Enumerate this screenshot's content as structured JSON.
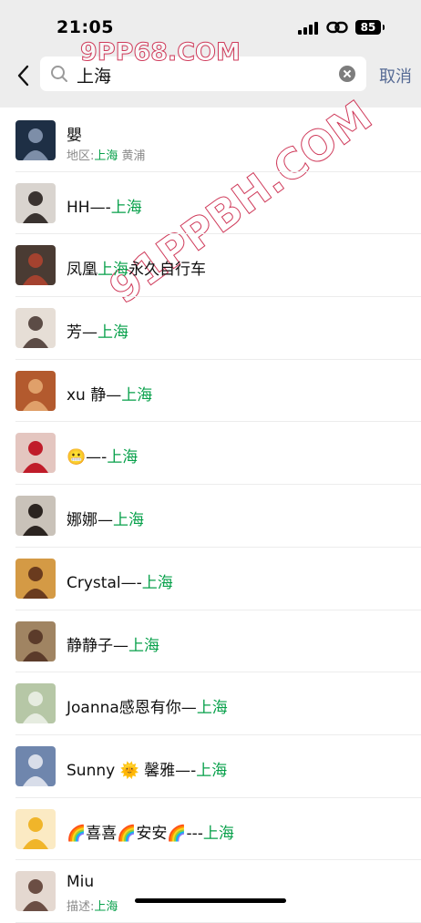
{
  "status": {
    "time": "21:05",
    "battery": "85"
  },
  "search": {
    "query": "上海",
    "cancel_label": "取消"
  },
  "watermark": {
    "top": "9PP68.COM",
    "diagonal": "91PPBH.COM"
  },
  "results": [
    {
      "name_pre": "嬰",
      "name_hl": "",
      "name_post": "",
      "sub_pre": "地区:",
      "sub_hl": "上海",
      "sub_post": " 黄浦",
      "avatar_bg": "#1e2f45",
      "avatar_fg": "#7d8ea8"
    },
    {
      "name_pre": "HH—-",
      "name_hl": "上海",
      "name_post": "",
      "avatar_bg": "#d9d4cf",
      "avatar_fg": "#3a3330"
    },
    {
      "name_pre": "凤凰",
      "name_hl": "上海",
      "name_post": "永久自行车",
      "avatar_bg": "#4a3b33",
      "avatar_fg": "#a4422f"
    },
    {
      "name_pre": "芳—",
      "name_hl": "上海",
      "name_post": "",
      "avatar_bg": "#e6ded6",
      "avatar_fg": "#5c4c46"
    },
    {
      "name_pre": "xu 静—",
      "name_hl": "上海",
      "name_post": "",
      "avatar_bg": "#b35a2e",
      "avatar_fg": "#e0a06a"
    },
    {
      "name_pre": "😬—-",
      "name_hl": "上海",
      "name_post": "",
      "avatar_bg": "#e4c6c0",
      "avatar_fg": "#c01c2a"
    },
    {
      "name_pre": "娜娜—",
      "name_hl": "上海",
      "name_post": "",
      "avatar_bg": "#c9c2b9",
      "avatar_fg": "#2b2420"
    },
    {
      "name_pre": "Crystal—-",
      "name_hl": "上海",
      "name_post": "",
      "avatar_bg": "#d49a45",
      "avatar_fg": "#6a3b1e"
    },
    {
      "name_pre": "静静子—",
      "name_hl": "上海",
      "name_post": "",
      "avatar_bg": "#a08462",
      "avatar_fg": "#5b3b2a"
    },
    {
      "name_pre": "Joanna感恩有你—",
      "name_hl": "上海",
      "name_post": "",
      "avatar_bg": "#b6c7a6",
      "avatar_fg": "#e6ece0"
    },
    {
      "name_pre": "Sunny 🌞 馨雅—-",
      "name_hl": "上海",
      "name_post": "",
      "avatar_bg": "#6f86ad",
      "avatar_fg": "#d8dde9"
    },
    {
      "name_pre": "🌈喜喜🌈安安🌈---",
      "name_hl": "上海",
      "name_post": "",
      "avatar_bg": "#fbeac3",
      "avatar_fg": "#f0b52a"
    },
    {
      "name_pre": "Miu",
      "name_hl": "",
      "name_post": "",
      "sub_pre": "描述:",
      "sub_hl": "上海",
      "sub_post": "",
      "avatar_bg": "#e4d8d0",
      "avatar_fg": "#6b4e44"
    }
  ]
}
